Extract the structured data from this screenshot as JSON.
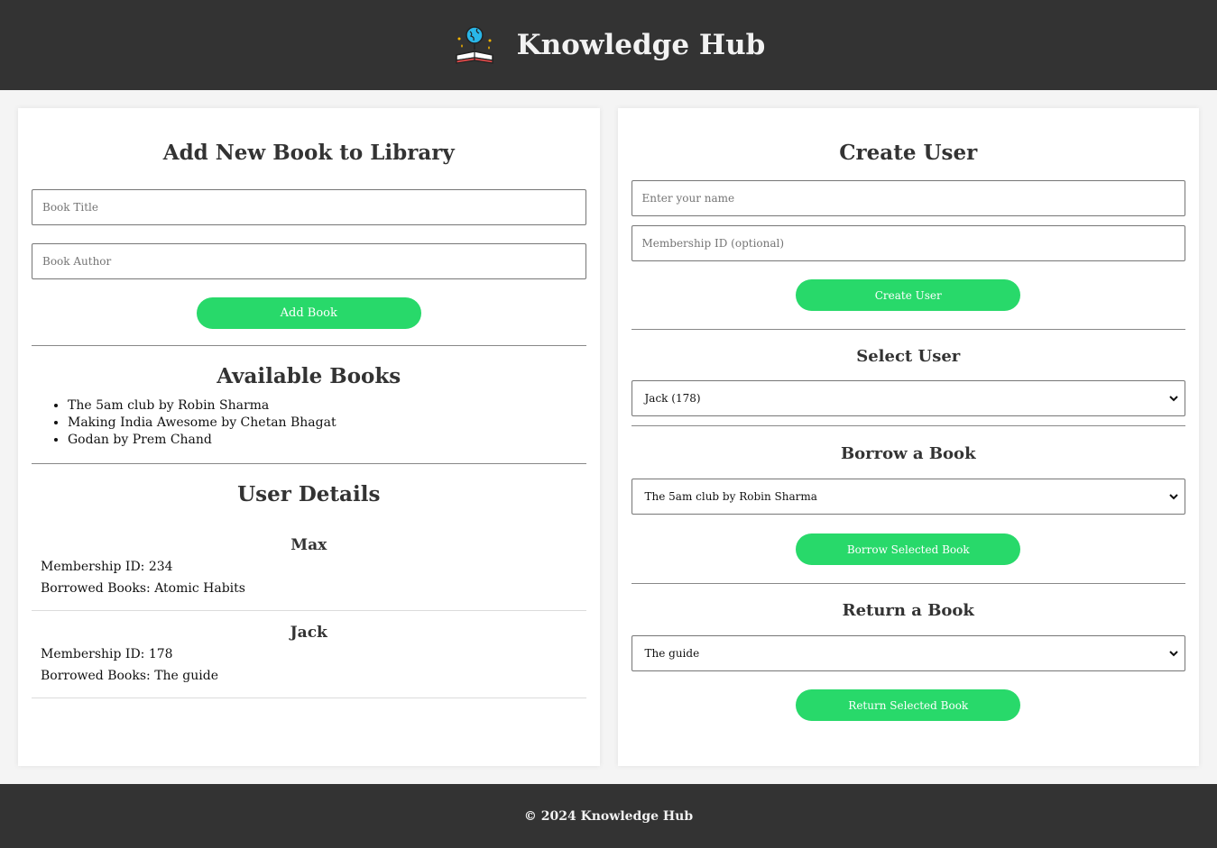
{
  "header": {
    "title": "Knowledge Hub",
    "logo_icon": "book-globe-icon"
  },
  "add_book": {
    "heading": "Add New Book to Library",
    "title_placeholder": "Book Title",
    "author_placeholder": "Book Author",
    "button_label": "Add Book"
  },
  "available_books": {
    "heading": "Available Books",
    "items": [
      "The 5am club by Robin Sharma",
      "Making India Awesome by Chetan Bhagat",
      "Godan by Prem Chand"
    ]
  },
  "user_details": {
    "heading": "User Details",
    "users": [
      {
        "name": "Max",
        "membership": "Membership ID: 234",
        "borrowed": "Borrowed Books: Atomic Habits"
      },
      {
        "name": "Jack",
        "membership": "Membership ID: 178",
        "borrowed": "Borrowed Books: The guide"
      }
    ]
  },
  "create_user": {
    "heading": "Create User",
    "name_placeholder": "Enter your name",
    "membership_placeholder": "Membership ID (optional)",
    "button_label": "Create User"
  },
  "select_user": {
    "heading": "Select User",
    "selected": "Jack (178)"
  },
  "borrow": {
    "heading": "Borrow a Book",
    "selected": "The 5am club by Robin Sharma",
    "button_label": "Borrow Selected Book"
  },
  "return_book": {
    "heading": "Return a Book",
    "selected": "The guide",
    "button_label": "Return Selected Book"
  },
  "footer": {
    "text": "© 2024 Knowledge Hub"
  },
  "colors": {
    "header_bg": "#333333",
    "accent": "#28d96a",
    "page_bg": "#f4f4f4"
  }
}
